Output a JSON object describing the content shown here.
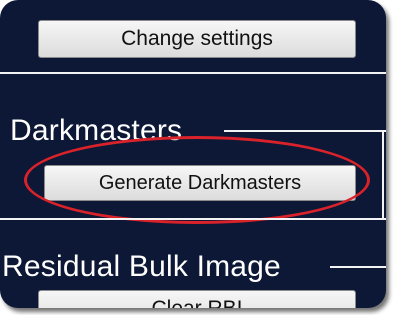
{
  "settings": {
    "change_label": "Change settings"
  },
  "darkmasters": {
    "heading": "Darkmasters",
    "generate_label": "Generate Darkmasters"
  },
  "rbi": {
    "heading": "Residual Bulk Image",
    "clear_label": "Clear RBI"
  },
  "colors": {
    "panel_background": "#0d1736",
    "highlight": "#d9222a",
    "button_face": "#e8e8e8"
  }
}
